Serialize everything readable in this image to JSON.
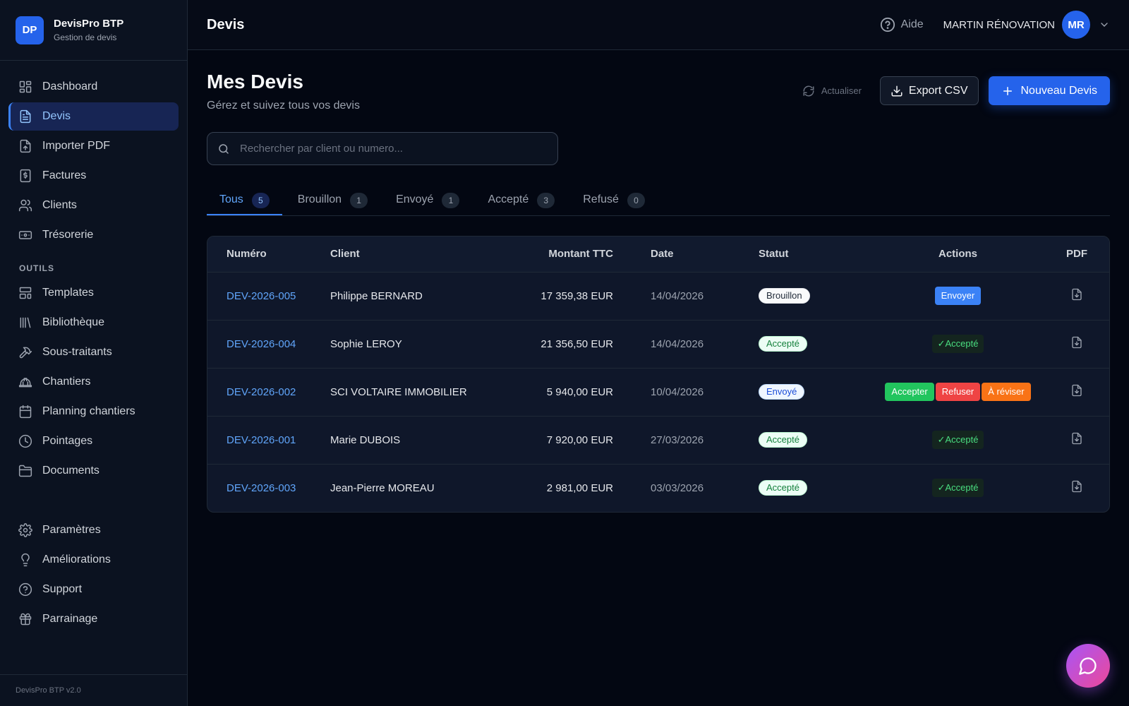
{
  "brand": {
    "logo": "DP",
    "name": "DevisPro BTP",
    "subtitle": "Gestion de devis"
  },
  "sidebar": {
    "main_items": [
      {
        "label": "Dashboard",
        "icon": "dashboard-icon"
      },
      {
        "label": "Devis",
        "icon": "document-icon",
        "active": true
      },
      {
        "label": "Importer PDF",
        "icon": "file-upload-icon"
      },
      {
        "label": "Factures",
        "icon": "invoice-icon"
      },
      {
        "label": "Clients",
        "icon": "users-icon"
      },
      {
        "label": "Trésorerie",
        "icon": "banknote-icon"
      }
    ],
    "tools_title": "OUTILS",
    "tool_items": [
      {
        "label": "Templates",
        "icon": "template-icon"
      },
      {
        "label": "Bibliothèque",
        "icon": "library-icon"
      },
      {
        "label": "Sous-traitants",
        "icon": "hammer-icon"
      },
      {
        "label": "Chantiers",
        "icon": "hard-hat-icon"
      },
      {
        "label": "Planning chantiers",
        "icon": "calendar-icon"
      },
      {
        "label": "Pointages",
        "icon": "clock-icon"
      },
      {
        "label": "Documents",
        "icon": "folder-icon"
      }
    ],
    "bottom_items": [
      {
        "label": "Paramètres",
        "icon": "gear-icon"
      },
      {
        "label": "Améliorations",
        "icon": "lightbulb-icon"
      },
      {
        "label": "Support",
        "icon": "help-circle-icon"
      },
      {
        "label": "Parrainage",
        "icon": "gift-icon"
      }
    ],
    "footer": "DevisPro BTP v2.0"
  },
  "topbar": {
    "title": "Devis",
    "help_label": "Aide",
    "company": "MARTIN RÉNOVATION",
    "avatar_initials": "MR"
  },
  "page": {
    "title": "Mes Devis",
    "subtitle": "Gérez et suivez tous vos devis",
    "refresh_label": "Actualiser",
    "export_label": "Export CSV",
    "new_label": "Nouveau Devis",
    "search_placeholder": "Rechercher par client ou numero..."
  },
  "tabs": [
    {
      "label": "Tous",
      "count": "5",
      "active": true
    },
    {
      "label": "Brouillon",
      "count": "1"
    },
    {
      "label": "Envoyé",
      "count": "1"
    },
    {
      "label": "Accepté",
      "count": "3"
    },
    {
      "label": "Refusé",
      "count": "0"
    }
  ],
  "table": {
    "headers": {
      "number": "Numéro",
      "client": "Client",
      "amount": "Montant TTC",
      "date": "Date",
      "status": "Statut",
      "actions": "Actions",
      "pdf": "PDF"
    },
    "rows": [
      {
        "number": "DEV-2026-005",
        "client": "Philippe BERNARD",
        "amount": "17 359,38 EUR",
        "date": "14/04/2026",
        "status": "Brouillon",
        "status_class": "Brouillon",
        "actions": [
          {
            "type": "button",
            "label": "Envoyer",
            "color": "blue"
          }
        ]
      },
      {
        "number": "DEV-2026-004",
        "client": "Sophie LEROY",
        "amount": "21 356,50 EUR",
        "date": "14/04/2026",
        "status": "Accepté",
        "status_class": "Accepte",
        "actions": [
          {
            "type": "label",
            "label": "✓Accepté"
          }
        ]
      },
      {
        "number": "DEV-2026-002",
        "client": "SCI VOLTAIRE IMMOBILIER",
        "amount": "5 940,00 EUR",
        "date": "10/04/2026",
        "status": "Envoyé",
        "status_class": "Envoye",
        "actions": [
          {
            "type": "button",
            "label": "Accepter",
            "color": "green"
          },
          {
            "type": "button",
            "label": "Refuser",
            "color": "red"
          },
          {
            "type": "button",
            "label": "À réviser",
            "color": "orange"
          }
        ]
      },
      {
        "number": "DEV-2026-001",
        "client": "Marie DUBOIS",
        "amount": "7 920,00 EUR",
        "date": "27/03/2026",
        "status": "Accepté",
        "status_class": "Accepte",
        "actions": [
          {
            "type": "label",
            "label": "✓Accepté"
          }
        ]
      },
      {
        "number": "DEV-2026-003",
        "client": "Jean-Pierre MOREAU",
        "amount": "2 981,00 EUR",
        "date": "03/03/2026",
        "status": "Accepté",
        "status_class": "Accepte",
        "actions": [
          {
            "type": "label",
            "label": "✓Accepté"
          }
        ]
      }
    ]
  },
  "colors": {
    "accent": "#2563eb",
    "background": "#030712",
    "sidebar": "#0b1220",
    "link": "#60a5fa"
  }
}
